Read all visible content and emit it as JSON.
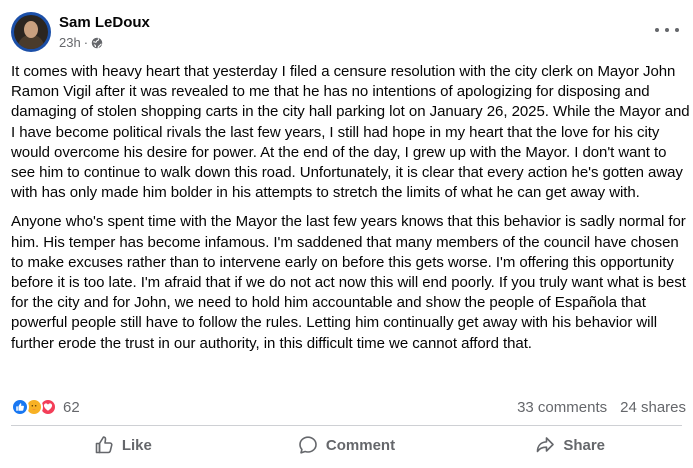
{
  "post": {
    "author": "Sam LeDoux",
    "time": "23h",
    "separator": "·",
    "paragraphs": [
      "It comes with heavy heart that yesterday I filed a censure resolution with the city clerk on Mayor John Ramon Vigil after it was revealed to me that he has no intentions of apologizing for disposing and damaging of stolen shopping carts in the city hall parking lot on January 26, 2025. While the Mayor and I have become political rivals the last few years, I still had hope in my heart that the love for his city would overcome his desire for power. At the end of the day, I grew up with the Mayor. I don't want to see him to continue to walk down this road. Unfortunately, it is clear that every action he's gotten away with has only made him bolder in his attempts to stretch the limits of what he can get away with.",
      "Anyone who's spent time with the Mayor the last few years knows that this behavior is sadly normal for him. His temper has become infamous. I'm saddened that many members of the council have chosen to make excuses rather than to intervene early on before this gets worse. I'm offering this opportunity before it is too late. I'm afraid that if we do not act now this will end poorly. If you truly want what is best for the city and for John, we need to hold him accountable and show the people of Española that powerful people still have to follow the rules. Letting him continually get away with his behavior will further erode the trust in our authority, in this difficult time we cannot afford that."
    ]
  },
  "stats": {
    "reaction_count": "62",
    "reaction_icons": [
      "like-icon",
      "care-icon",
      "love-icon"
    ],
    "comments": "33 comments",
    "shares": "24 shares"
  },
  "actions": {
    "like": "Like",
    "comment": "Comment",
    "share": "Share"
  },
  "colors": {
    "text": "#050505",
    "secondary": "#65676b",
    "like_blue": "#1877f2",
    "care_yellow": "#f7b125",
    "love_red": "#f33e58",
    "divider": "#ced0d4"
  }
}
